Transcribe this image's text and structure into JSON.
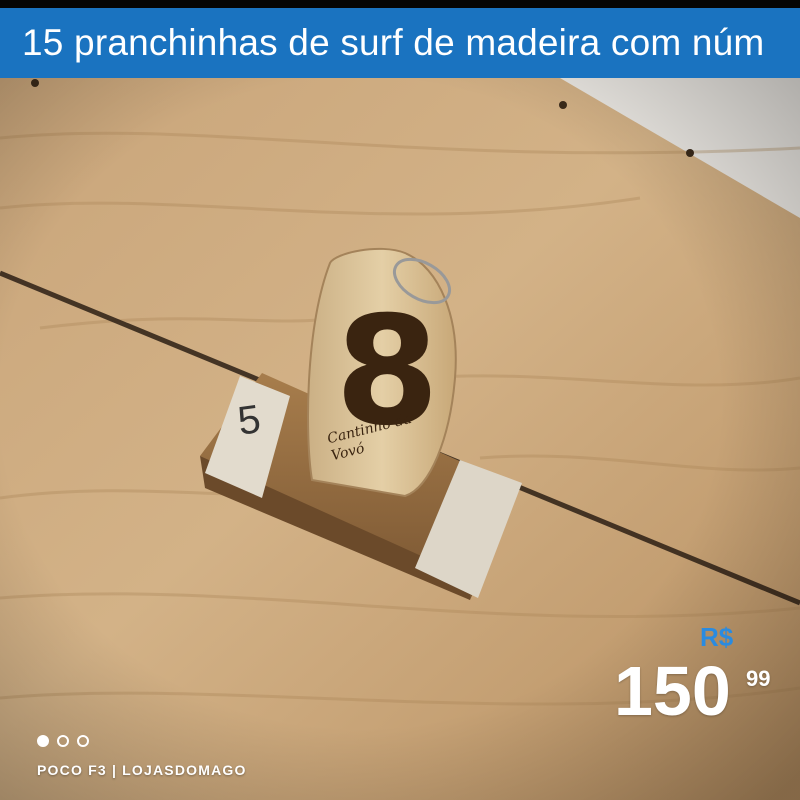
{
  "listing": {
    "title": "15 pranchinhas de surf de madeira com núm",
    "price": {
      "currency": "R$",
      "whole": "150",
      "cents": "99"
    },
    "carousel": {
      "total": 3,
      "active_index": 0
    },
    "footer": "POCO F3 | LOJASDOMAGO"
  },
  "photo": {
    "tag_small_number": "5",
    "tag_large_number": "8",
    "tag_engraving": [
      "Cantinho da",
      "Vovó"
    ]
  },
  "colors": {
    "title_bar": "#1a73c0",
    "currency": "#2a8be0",
    "wood_light": "#d8b98b",
    "wood_dark": "#8b6a43",
    "burnt_number": "#3a2410"
  }
}
